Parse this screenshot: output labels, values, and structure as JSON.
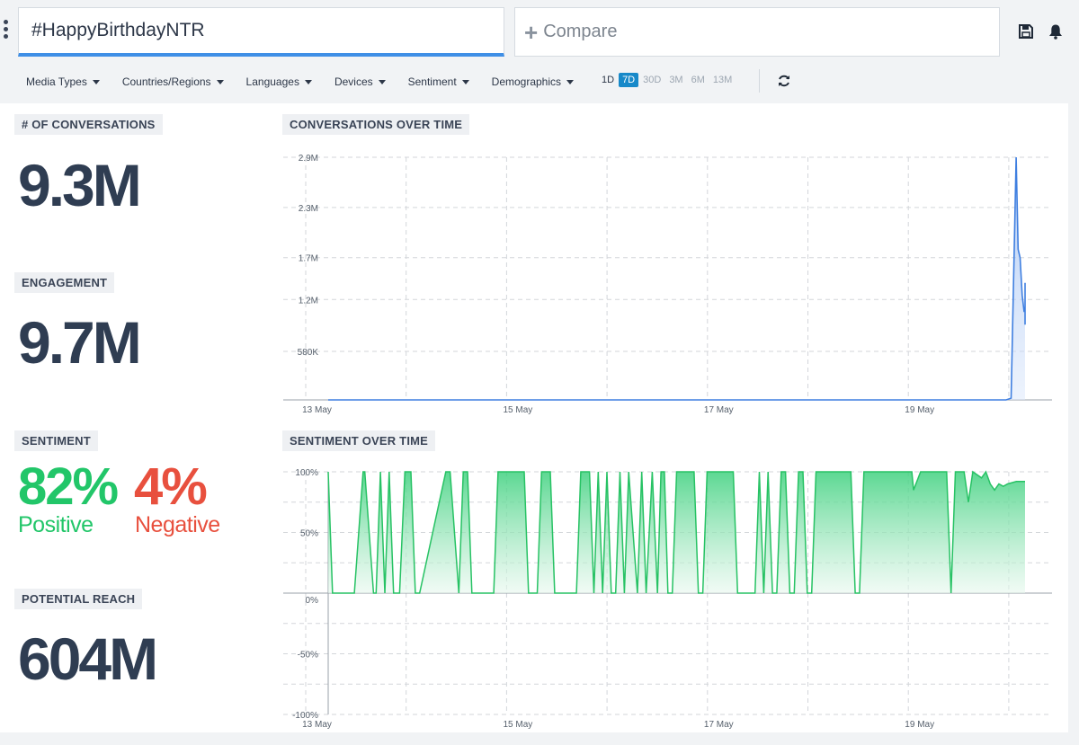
{
  "search": {
    "query": "#HappyBirthdayNTR",
    "compare_placeholder": "Compare"
  },
  "icons": {
    "menu": "kebab-menu-icon",
    "save": "save-icon",
    "bell": "bell-icon",
    "refresh": "refresh-icon",
    "add": "plus-icon"
  },
  "filters": [
    "Media Types",
    "Countries/Regions",
    "Languages",
    "Devices",
    "Sentiment",
    "Demographics"
  ],
  "ranges": [
    {
      "label": "1D",
      "active": false
    },
    {
      "label": "7D",
      "active": true
    },
    {
      "label": "30D",
      "active": false
    },
    {
      "label": "3M",
      "active": false
    },
    {
      "label": "6M",
      "active": false
    },
    {
      "label": "13M",
      "active": false
    }
  ],
  "stats": {
    "conversations": {
      "label": "# OF CONVERSATIONS",
      "value": "9.3M"
    },
    "engagement": {
      "label": "ENGAGEMENT",
      "value": "9.7M"
    },
    "sentiment": {
      "label": "SENTIMENT",
      "positive_value": "82%",
      "positive_label": "Positive",
      "negative_value": "4%",
      "negative_label": "Negative"
    },
    "reach": {
      "label": "POTENTIAL REACH",
      "value": "604M"
    }
  },
  "colors": {
    "positive": "#22c669",
    "negative": "#e8503e",
    "accent": "#1789c9",
    "line": "#3f7fe0",
    "sentiment_line": "#27c264"
  },
  "chart_data": [
    {
      "type": "area",
      "title": "CONVERSATIONS OVER TIME",
      "x_tick_labels": [
        "13 May",
        "15 May",
        "17 May",
        "19 May"
      ],
      "y_tick_labels": [
        "580K",
        "1.2M",
        "1.7M",
        "2.3M",
        "2.9M"
      ],
      "y_ticks": [
        580000,
        1200000,
        1700000,
        2300000,
        2900000
      ],
      "x_range_days": [
        13,
        20
      ],
      "ylim": [
        0,
        2900000
      ],
      "grid": true,
      "series": [
        {
          "x": [
            12.0,
            19.7,
            19.75,
            19.8,
            19.82,
            19.84,
            19.86,
            19.88,
            19.9,
            19.92,
            19.94,
            19.96,
            19.98,
            20.0
          ],
          "values": [
            0,
            0,
            20000,
            2900000,
            1800000,
            1700000,
            1250000,
            1050000,
            1100000,
            1300000,
            1200000,
            1350000,
            1400000,
            900000
          ]
        }
      ]
    },
    {
      "type": "area",
      "title": "SENTIMENT OVER TIME",
      "x_tick_labels": [
        "13 May",
        "15 May",
        "17 May",
        "19 May"
      ],
      "y_tick_labels": [
        "100%",
        "50%",
        "0%",
        "-50%",
        "-100%"
      ],
      "y_ticks": [
        100,
        50,
        0,
        -50,
        -100
      ],
      "ylim": [
        -100,
        100
      ],
      "grid": true,
      "series": [
        {
          "x": [
            12.0,
            12.05,
            12.1,
            12.3,
            12.4,
            12.42,
            12.52,
            12.55,
            12.6,
            12.65,
            12.7,
            12.75,
            12.78,
            12.82,
            12.88,
            12.95,
            13.0,
            13.05,
            13.35,
            13.4,
            13.5,
            13.55,
            13.6,
            13.65,
            13.9,
            13.95,
            14.25,
            14.3,
            14.4,
            14.45,
            14.55,
            14.6,
            14.85,
            14.9,
            15.0,
            15.05,
            15.1,
            15.15,
            15.2,
            15.25,
            15.3,
            15.35,
            15.4,
            15.45,
            15.55,
            15.6,
            15.65,
            15.72,
            15.78,
            15.82,
            15.86,
            15.9,
            15.95,
            16.0,
            16.2,
            16.25,
            16.3,
            16.35,
            16.65,
            16.7,
            16.9,
            16.95,
            17.0,
            17.05,
            17.1,
            17.15,
            17.2,
            17.25,
            17.3,
            17.35,
            17.4,
            17.45,
            17.5,
            17.55,
            17.6,
            17.65,
            18.0,
            18.05,
            18.1,
            18.15,
            18.7,
            18.72,
            18.8,
            18.82,
            18.95,
            19.05,
            19.1,
            19.15,
            19.2,
            19.3,
            19.35,
            19.4,
            19.5,
            19.55,
            19.6,
            19.65,
            19.7,
            19.75,
            19.8,
            19.9,
            20.0
          ],
          "values": [
            100,
            0,
            0,
            0,
            100,
            100,
            0,
            0,
            100,
            0,
            100,
            0,
            0,
            0,
            100,
            100,
            0,
            0,
            100,
            100,
            0,
            100,
            100,
            0,
            0,
            100,
            100,
            0,
            0,
            100,
            100,
            0,
            0,
            100,
            100,
            0,
            100,
            0,
            100,
            0,
            0,
            100,
            0,
            100,
            0,
            100,
            0,
            100,
            0,
            100,
            100,
            0,
            0,
            100,
            100,
            0,
            0,
            100,
            100,
            0,
            0,
            100,
            0,
            100,
            0,
            0,
            100,
            100,
            0,
            0,
            100,
            100,
            0,
            0,
            100,
            100,
            100,
            0,
            0,
            100,
            100,
            85,
            100,
            100,
            100,
            100,
            100,
            0,
            100,
            100,
            75,
            100,
            95,
            100,
            90,
            85,
            90,
            88,
            90,
            92,
            92
          ]
        }
      ]
    }
  ]
}
